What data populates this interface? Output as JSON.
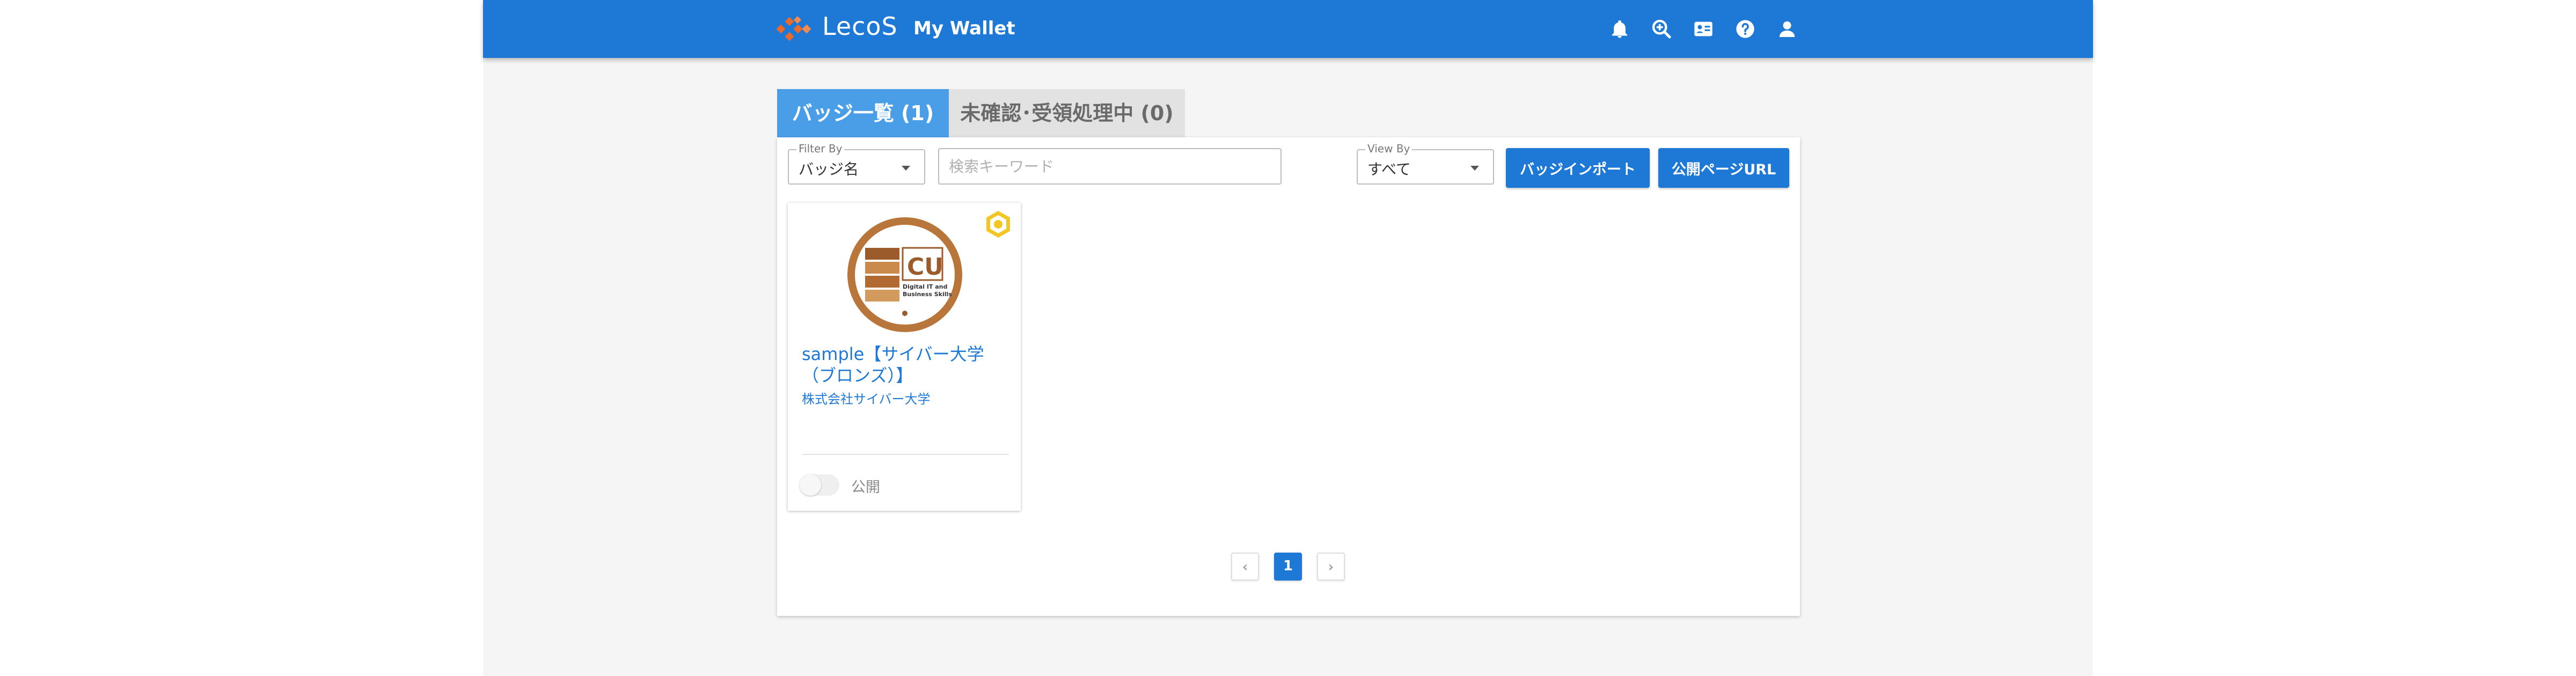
{
  "header": {
    "brand": "LecoS",
    "title": "My Wallet",
    "icons": [
      "bell-icon",
      "zoom-search-icon",
      "id-card-icon",
      "help-icon",
      "user-icon"
    ]
  },
  "tabs": [
    {
      "label": "バッジ一覧 (1)",
      "active": true
    },
    {
      "label": "未確認･受領処理中 (0)",
      "active": false
    }
  ],
  "filters": {
    "filter_by": {
      "legend": "Filter By",
      "value": "バッジ名"
    },
    "search": {
      "placeholder": "検索キーワード",
      "value": ""
    },
    "view_by": {
      "legend": "View By",
      "value": "すべて"
    }
  },
  "buttons": {
    "import": "バッジインポート",
    "public_url": "公開ページURL"
  },
  "badges": [
    {
      "title": "sample【サイバー大学（ブロンズ）】",
      "issuer": "株式会社サイバー大学",
      "public_label": "公開",
      "public": false,
      "image_text": {
        "main": "CU",
        "line1": "Digital IT and",
        "line2": "Business Skills"
      }
    }
  ],
  "pagination": {
    "prev": "‹",
    "current": "1",
    "next": "›"
  },
  "colors": {
    "primary": "#1e78d6",
    "tab_active": "#4a9ee8",
    "badge_bronze": "#b8763a",
    "flag_yellow": "#f3c623"
  }
}
